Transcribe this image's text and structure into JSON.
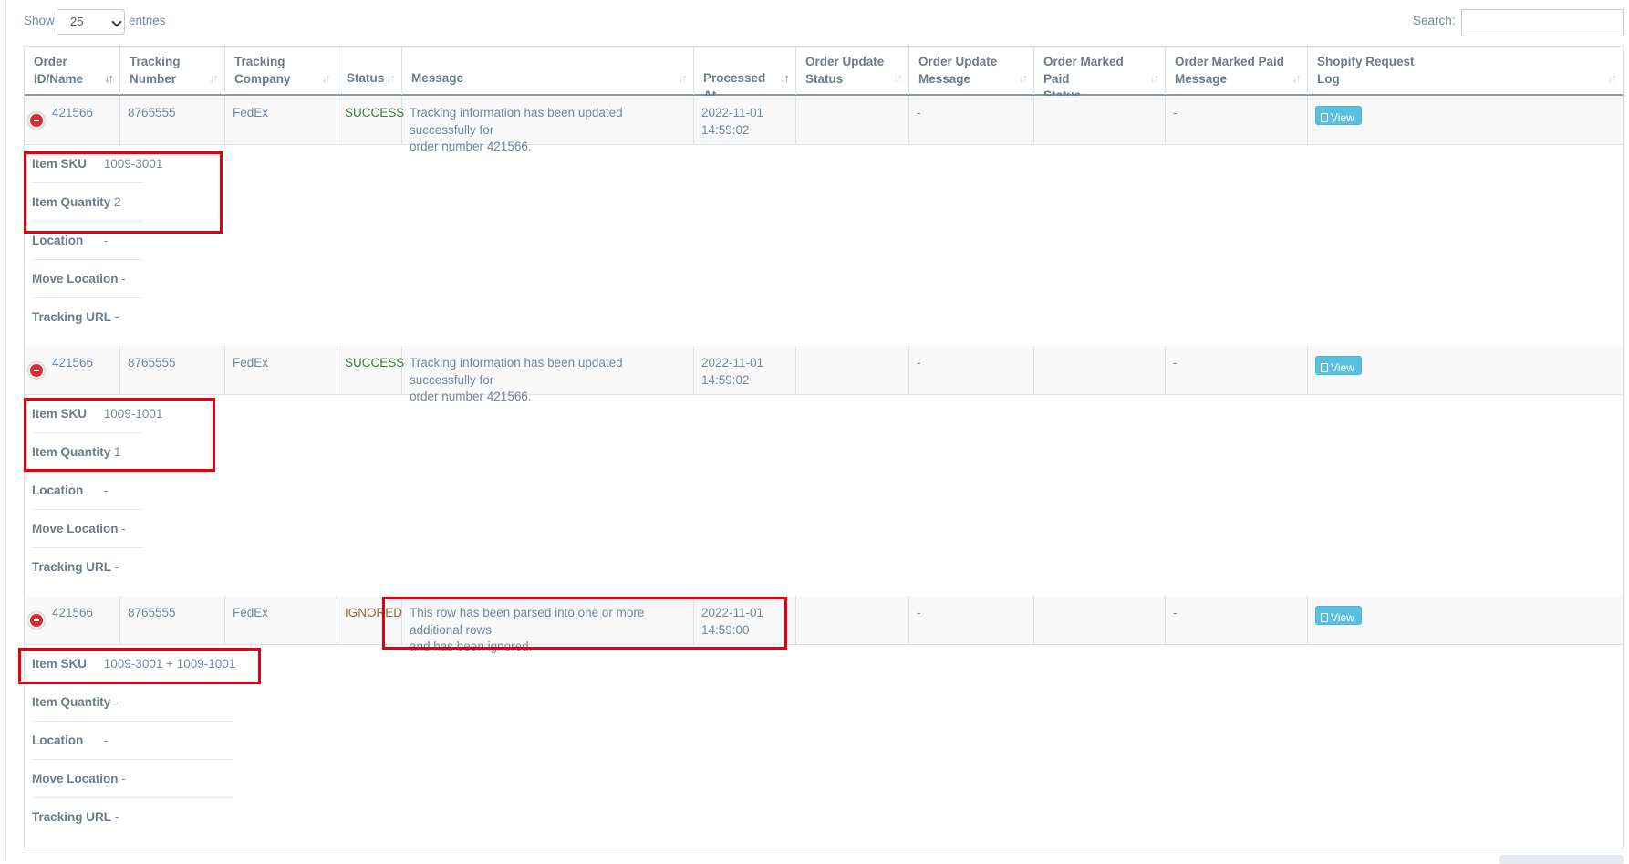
{
  "controls": {
    "show_label": "Show",
    "page_length": "25",
    "entries_label": "entries",
    "search_label": "Search:",
    "search_value": ""
  },
  "columns": [
    {
      "label": "Order ID/Name",
      "line1": "Order",
      "line2": "ID/Name"
    },
    {
      "label": "Tracking Number",
      "line1": "Tracking",
      "line2": "Number"
    },
    {
      "label": "Tracking Company",
      "line1": "Tracking",
      "line2": "Company"
    },
    {
      "label": "Status",
      "line1": "",
      "line2": "Status"
    },
    {
      "label": "Message",
      "line1": "",
      "line2": "Message"
    },
    {
      "label": "Processed At",
      "line1": "",
      "line2": "Processed At"
    },
    {
      "label": "Order Update Status",
      "line1": "Order Update",
      "line2": "Status"
    },
    {
      "label": "Order Update Message",
      "line1": "Order Update",
      "line2": "Message"
    },
    {
      "label": "Order Marked Paid Status",
      "line1": "Order Marked Paid",
      "line2": "Status"
    },
    {
      "label": "Order Marked Paid Message",
      "line1": "Order Marked Paid",
      "line2": "Message"
    },
    {
      "label": "Shopify Request Log",
      "line1": "Shopify Request",
      "line2": "Log"
    }
  ],
  "rows": [
    {
      "order": "421566",
      "tracking_number": "8765555",
      "company": "FedEx",
      "status": "SUCCESS",
      "message_l1": "Tracking information has been updated successfully for",
      "message_l2": "order number 421566.",
      "processed_date": "2022-11-01",
      "processed_time": "14:59:02",
      "update_status": "",
      "update_message": "-",
      "paid_status": "",
      "paid_message": "-",
      "log_button": "View",
      "details": {
        "sku_label": "Item SKU",
        "sku": "1009-3001",
        "qty_label": "Item Quantity",
        "qty": "2",
        "location_label": "Location",
        "location": "-",
        "move_label": "Move Location",
        "move": "-",
        "url_label": "Tracking URL",
        "url": "-"
      }
    },
    {
      "order": "421566",
      "tracking_number": "8765555",
      "company": "FedEx",
      "status": "SUCCESS",
      "message_l1": "Tracking information has been updated successfully for",
      "message_l2": "order number 421566.",
      "processed_date": "2022-11-01",
      "processed_time": "14:59:02",
      "update_status": "",
      "update_message": "-",
      "paid_status": "",
      "paid_message": "-",
      "log_button": "View",
      "details": {
        "sku_label": "Item SKU",
        "sku": "1009-1001",
        "qty_label": "Item Quantity",
        "qty": "1",
        "location_label": "Location",
        "location": "-",
        "move_label": "Move Location",
        "move": "-",
        "url_label": "Tracking URL",
        "url": "-"
      }
    },
    {
      "order": "421566",
      "tracking_number": "8765555",
      "company": "FedEx",
      "status": "IGNORED",
      "message_l1": "This row has been parsed into one or more additional rows",
      "message_l2": "and has been ignored.",
      "processed_date": "2022-11-01",
      "processed_time": "14:59:00",
      "update_status": "",
      "update_message": "-",
      "paid_status": "",
      "paid_message": "-",
      "log_button": "View",
      "details": {
        "sku_label": "Item SKU",
        "sku": "1009-3001 + 1009-1001",
        "qty_label": "Item Quantity",
        "qty": "-",
        "location_label": "Location",
        "location": "-",
        "move_label": "Move Location",
        "move": "-",
        "url_label": "Tracking URL",
        "url": "-"
      }
    }
  ],
  "colors": {
    "success": "#3c763d",
    "ignored": "#8a6d3b",
    "view_button": "#5bc0de",
    "remove_icon": "#d32f2f",
    "highlight_box": "#e0000f"
  }
}
